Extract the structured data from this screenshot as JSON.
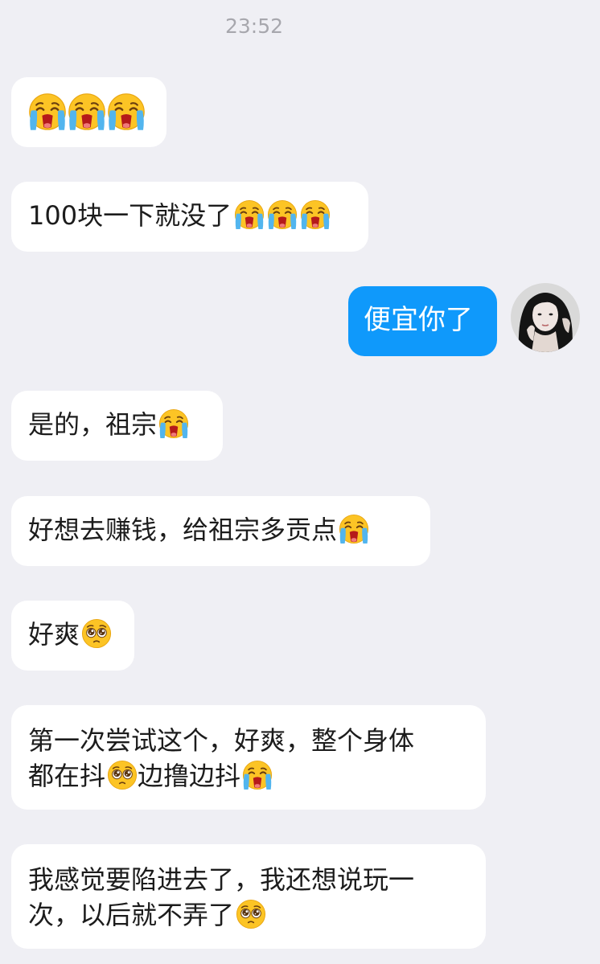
{
  "chat": {
    "timestamp": "23:52",
    "messages": [
      {
        "sender": "other",
        "text": "",
        "emojis": [
          "loudly-crying-face",
          "loudly-crying-face",
          "loudly-crying-face"
        ]
      },
      {
        "sender": "other",
        "text": "100块一下就没了",
        "emojis": [
          "loudly-crying-face",
          "loudly-crying-face",
          "loudly-crying-face"
        ]
      },
      {
        "sender": "me",
        "text": "便宜你了"
      },
      {
        "sender": "other",
        "text": "是的，祖宗",
        "emojis": [
          "loudly-crying-face"
        ]
      },
      {
        "sender": "other",
        "text": "好想去赚钱，给祖宗多贡点",
        "emojis": [
          "loudly-crying-face"
        ]
      },
      {
        "sender": "other",
        "text": "好爽",
        "emojis": [
          "pleading-face"
        ]
      },
      {
        "sender": "other",
        "line1": "第一次尝试这个，好爽，整个身体",
        "line2_a": "都在抖",
        "line2_b": "边撸边抖",
        "emojis": [
          "pleading-face",
          "loudly-crying-face"
        ]
      },
      {
        "sender": "other",
        "line1": "我感觉要陷进去了，我还想说玩一",
        "line2": "次，以后就不弄了",
        "emojis": [
          "pleading-face"
        ]
      }
    ]
  },
  "avatar": {
    "icon": "user-avatar",
    "hair_color": "#141414",
    "skin_color": "#efe6e2"
  }
}
